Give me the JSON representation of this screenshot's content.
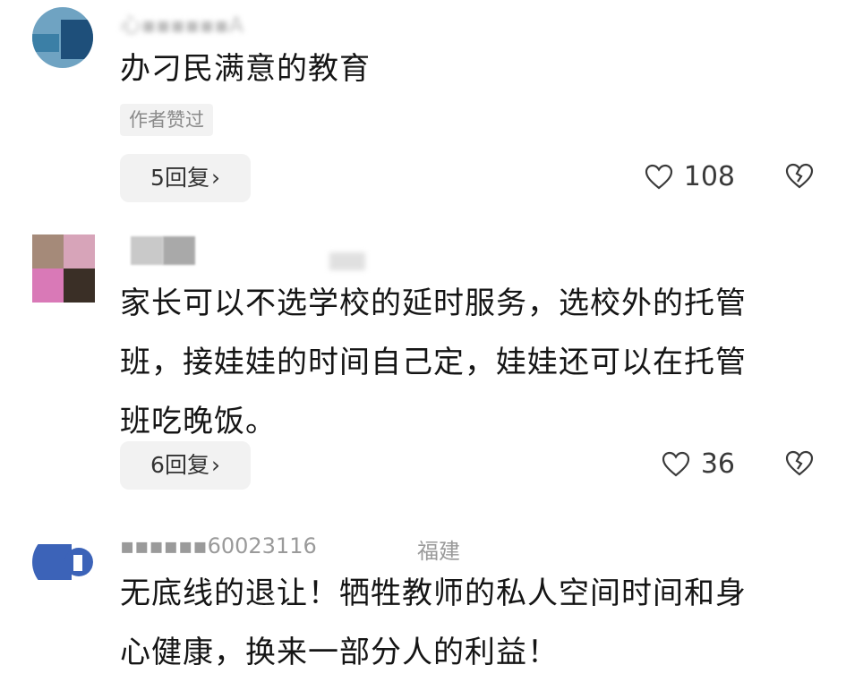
{
  "comments": [
    {
      "username": "心▪▪▪▪▪▪A",
      "text_lines": [
        "办刁民满意的教育"
      ],
      "tag": "作者赞过",
      "reply_count": "5回复",
      "likes": "108",
      "avatar_colors": [
        "#6fa3c2",
        "#1e4f7a"
      ]
    },
    {
      "username": "▪▪▪▪",
      "text_lines": [
        "家长可以不选学校的延时服务，选校外的托管",
        "班，接娃娃的时间自己定，娃娃还可以在托管",
        "班吃晚饭。"
      ],
      "reply_count": "6回复",
      "likes": "36",
      "avatar_colors": [
        "#a58a79",
        "#d7a4b9",
        "#d979b7",
        "#3a2f26"
      ]
    },
    {
      "username": "▪▪▪▪▪▪60023116",
      "location": "福建",
      "text_lines": [
        "无底线的退让！牺牲教师的私人空间时间和身",
        "心健康，换来一部分人的利益！"
      ],
      "avatar_colors": [
        "#3c63b8",
        "#ffffff"
      ]
    }
  ],
  "icons": {
    "like": "heart-outline-icon",
    "dislike": "broken-heart-icon",
    "reply_chevron": "›"
  },
  "chevron": "›"
}
